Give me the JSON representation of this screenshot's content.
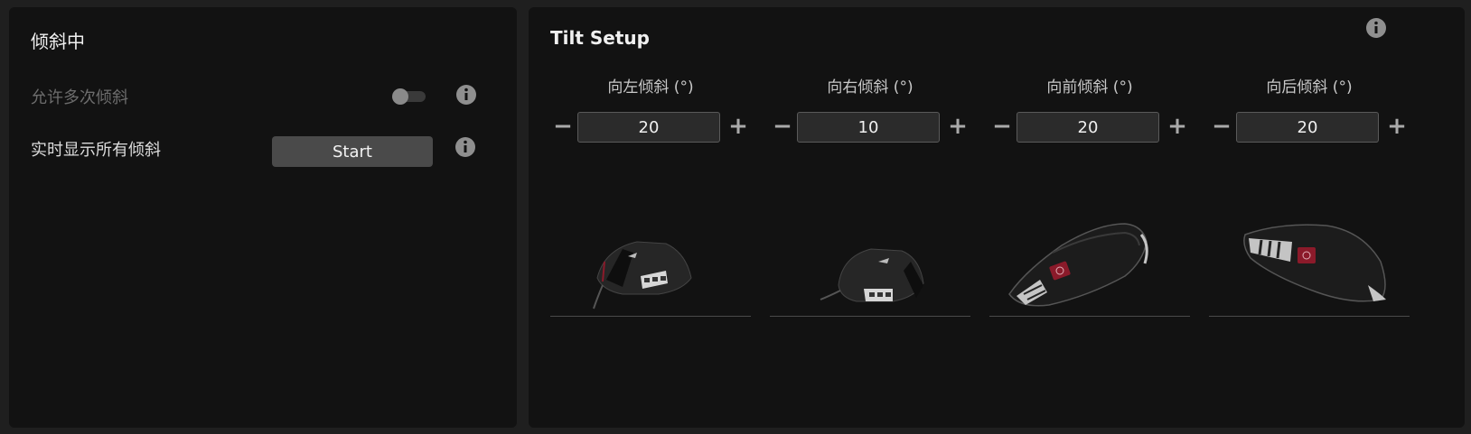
{
  "left_panel": {
    "title": "倾斜中",
    "allow_multi": {
      "label": "允许多次倾斜",
      "enabled": false
    },
    "live_display": {
      "label": "实时显示所有倾斜",
      "button_label": "Start"
    }
  },
  "right_panel": {
    "title": "Tilt Setup",
    "columns": [
      {
        "label": "向左倾斜 (°)",
        "value": "20"
      },
      {
        "label": "向右倾斜 (°)",
        "value": "10"
      },
      {
        "label": "向前倾斜 (°)",
        "value": "20"
      },
      {
        "label": "向后倾斜 (°)",
        "value": "20"
      }
    ]
  },
  "icons": {
    "info": "info-icon",
    "minus": "minus-icon",
    "plus": "plus-icon"
  },
  "colors": {
    "panel_bg": "#121212",
    "page_bg": "#1f1f1f",
    "button_bg": "#4a4a4a",
    "accent_red": "#8b1a2a"
  }
}
